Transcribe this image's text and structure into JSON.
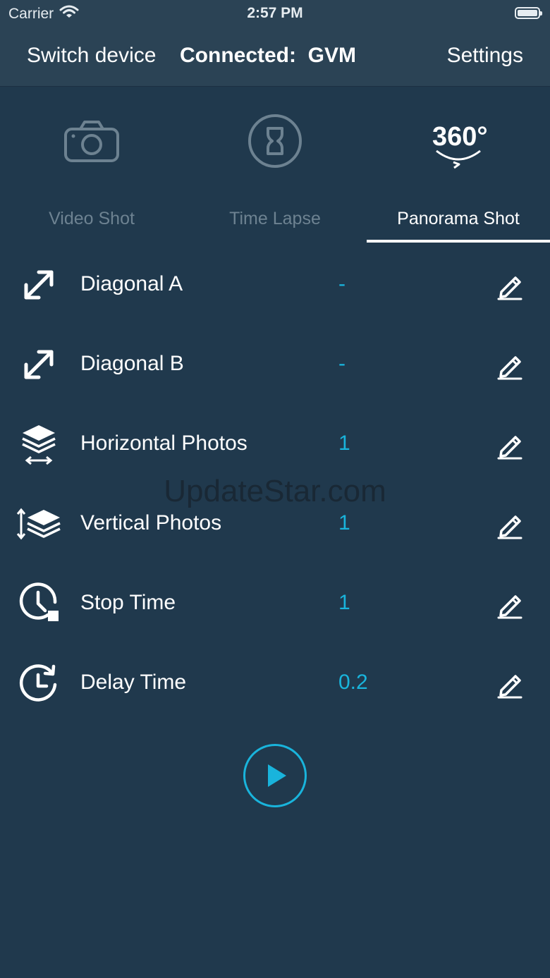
{
  "status_bar": {
    "carrier": "Carrier",
    "time": "2:57 PM"
  },
  "nav": {
    "left_label": "Switch device",
    "center_label": "Connected:  GVM",
    "right_label": "Settings"
  },
  "modes": [
    {
      "icon": "camera-icon"
    },
    {
      "icon": "hourglass-icon"
    },
    {
      "icon": "360-icon",
      "text": "360°"
    }
  ],
  "tabs": [
    {
      "label": "Video Shot",
      "active": false
    },
    {
      "label": "Time Lapse",
      "active": false
    },
    {
      "label": "Panorama Shot",
      "active": true
    }
  ],
  "settings": [
    {
      "label": "Diagonal A",
      "value": "-",
      "icon": "diagonal-arrow-icon"
    },
    {
      "label": "Diagonal B",
      "value": "-",
      "icon": "diagonal-arrow-icon"
    },
    {
      "label": "Horizontal Photos",
      "value": "1",
      "icon": "layers-horizontal-icon"
    },
    {
      "label": "Vertical Photos",
      "value": "1",
      "icon": "layers-vertical-icon"
    },
    {
      "label": "Stop Time",
      "value": "1",
      "icon": "clock-stop-icon"
    },
    {
      "label": "Delay Time",
      "value": "0.2",
      "icon": "clock-delay-icon"
    }
  ],
  "watermark": "UpdateStar.com",
  "colors": {
    "background": "#20394d",
    "bar": "#2b4355",
    "accent": "#19b4dc",
    "inactive_tab": "#6d8291"
  }
}
